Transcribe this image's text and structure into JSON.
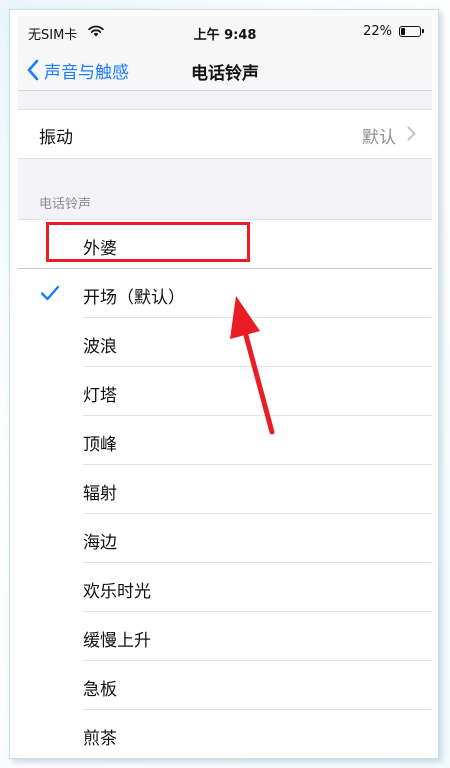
{
  "status_bar": {
    "carrier": "无SIM卡",
    "time": "上午 9:48",
    "battery_percent": "22%",
    "battery_level": 0.22,
    "wifi_icon": "wifi-icon",
    "battery_icon": "battery-icon"
  },
  "nav": {
    "back_label": "声音与触感",
    "back_icon": "chevron-left-icon",
    "title": "电话铃声"
  },
  "vibration": {
    "label": "振动",
    "value": "默认",
    "chevron_icon": "chevron-right-icon"
  },
  "ringtones": {
    "section_header": "电话铃声",
    "items": [
      {
        "name": "外婆",
        "selected": false
      },
      {
        "name": "开场（默认）",
        "selected": true
      },
      {
        "name": "波浪",
        "selected": false
      },
      {
        "name": "灯塔",
        "selected": false
      },
      {
        "name": "顶峰",
        "selected": false
      },
      {
        "name": "辐射",
        "selected": false
      },
      {
        "name": "海边",
        "selected": false
      },
      {
        "name": "欢乐时光",
        "selected": false
      },
      {
        "name": "缓慢上升",
        "selected": false
      },
      {
        "name": "急板",
        "selected": false
      },
      {
        "name": "煎茶",
        "selected": false
      }
    ],
    "check_icon": "checkmark-icon"
  },
  "colors": {
    "accent": "#1a7cff",
    "annotation": "#ea1d24"
  }
}
